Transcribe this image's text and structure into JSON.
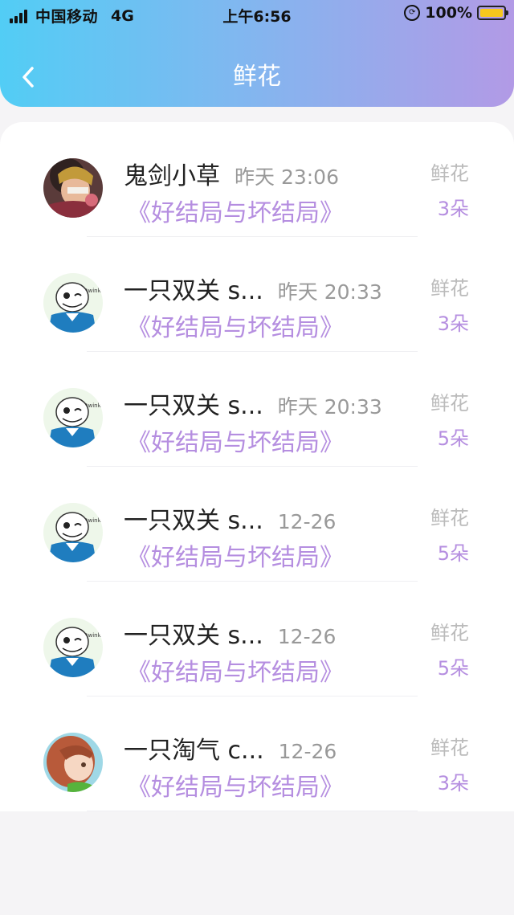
{
  "status_bar": {
    "carrier": "中国移动",
    "network": "4G",
    "time": "上午6:56",
    "battery_percent": "100%",
    "battery_color": "#f6c81d"
  },
  "header": {
    "title": "鲜花",
    "back_icon": "chevron-left-icon",
    "gradient_colors": [
      "#52cdf5",
      "#b29ae6"
    ]
  },
  "accent_color": "#b58ee0",
  "records": [
    {
      "avatar": "avatar-anime-warrior",
      "name": "鬼剑小草",
      "time": "昨天 23:06",
      "book": "《好结局与坏结局》",
      "gift": "鲜花",
      "count": "3朵"
    },
    {
      "avatar": "avatar-skeleton",
      "name": "一只双关 s...",
      "time": "昨天 20:33",
      "book": "《好结局与坏结局》",
      "gift": "鲜花",
      "count": "3朵"
    },
    {
      "avatar": "avatar-skeleton",
      "name": "一只双关 s...",
      "time": "昨天 20:33",
      "book": "《好结局与坏结局》",
      "gift": "鲜花",
      "count": "5朵"
    },
    {
      "avatar": "avatar-skeleton",
      "name": "一只双关 s...",
      "time": "12-26",
      "book": "《好结局与坏结局》",
      "gift": "鲜花",
      "count": "5朵"
    },
    {
      "avatar": "avatar-skeleton",
      "name": "一只双关 s...",
      "time": "12-26",
      "book": "《好结局与坏结局》",
      "gift": "鲜花",
      "count": "5朵"
    },
    {
      "avatar": "avatar-brown-hair-girl",
      "name": "一只淘气 c...",
      "time": "12-26",
      "book": "《好结局与坏结局》",
      "gift": "鲜花",
      "count": "3朵"
    }
  ]
}
